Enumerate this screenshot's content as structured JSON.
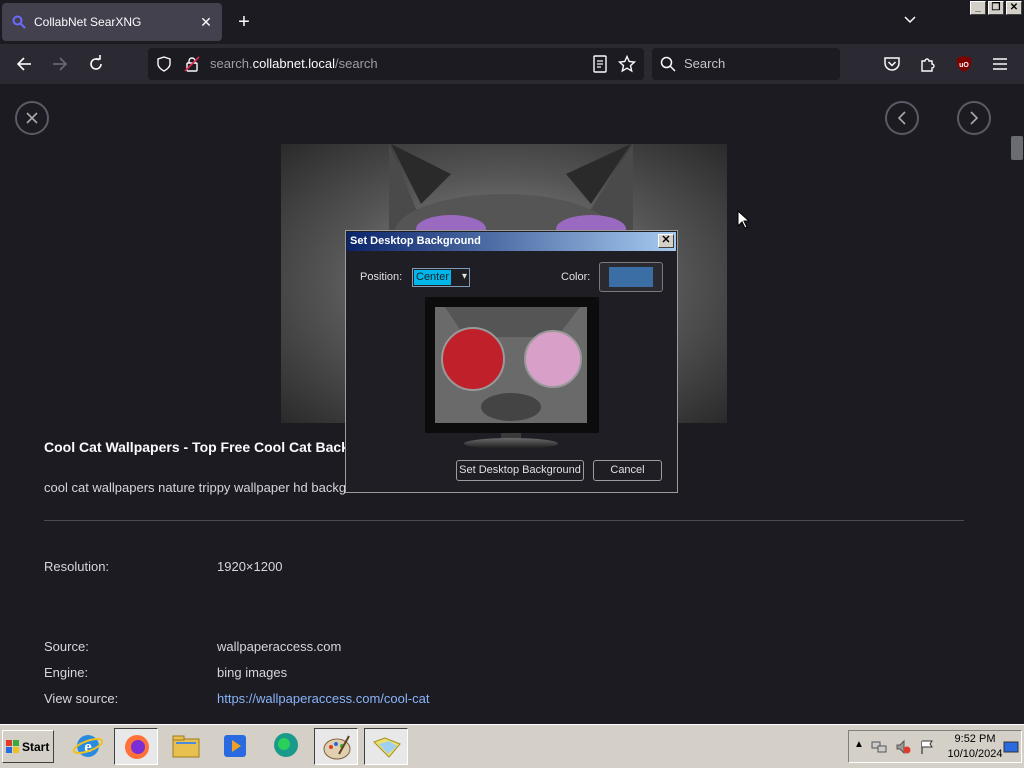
{
  "browser": {
    "tab_title": "CollabNet SearXNG",
    "tab_close": "✕",
    "new_tab": "+",
    "url_prefix": "search.",
    "url_domain": "collabnet.local",
    "url_path": "/search",
    "search_placeholder": "Search"
  },
  "page": {
    "result_title": "Cool Cat Wallpapers - Top Free Cool Cat Backg",
    "result_desc": "cool cat wallpapers nature trippy wallpaper hd backg",
    "resolution_label": "Resolution:",
    "resolution_value": "1920×1200",
    "source_label": "Source:",
    "source_value": "wallpaperaccess.com",
    "engine_label": "Engine:",
    "engine_value": "bing images",
    "view_source_label": "View source:",
    "view_source_value": "https://wallpaperaccess.com/cool-cat"
  },
  "dialog": {
    "title": "Set Desktop Background",
    "close": "✕",
    "position_label": "Position:",
    "position_value": "Center",
    "color_label": "Color:",
    "color_value": "#3a6ea5",
    "set_button": "Set Desktop Background",
    "cancel_button": "Cancel"
  },
  "taskbar": {
    "start_label": "Start",
    "time": "9:52 PM",
    "date": "10/10/2024",
    "apps": [
      "internet-explorer-icon",
      "firefox-icon",
      "file-explorer-icon",
      "media-player-icon",
      "messenger-icon",
      "paint-icon",
      "folder-icon"
    ]
  },
  "colors": {
    "page_bg": "#1c1b22",
    "nav_bg": "#2b2a33",
    "link": "#8ab4f8",
    "dialog_title_start": "#0a246a",
    "dialog_title_end": "#a6caf0",
    "taskbar_bg": "#d4d0c8"
  }
}
